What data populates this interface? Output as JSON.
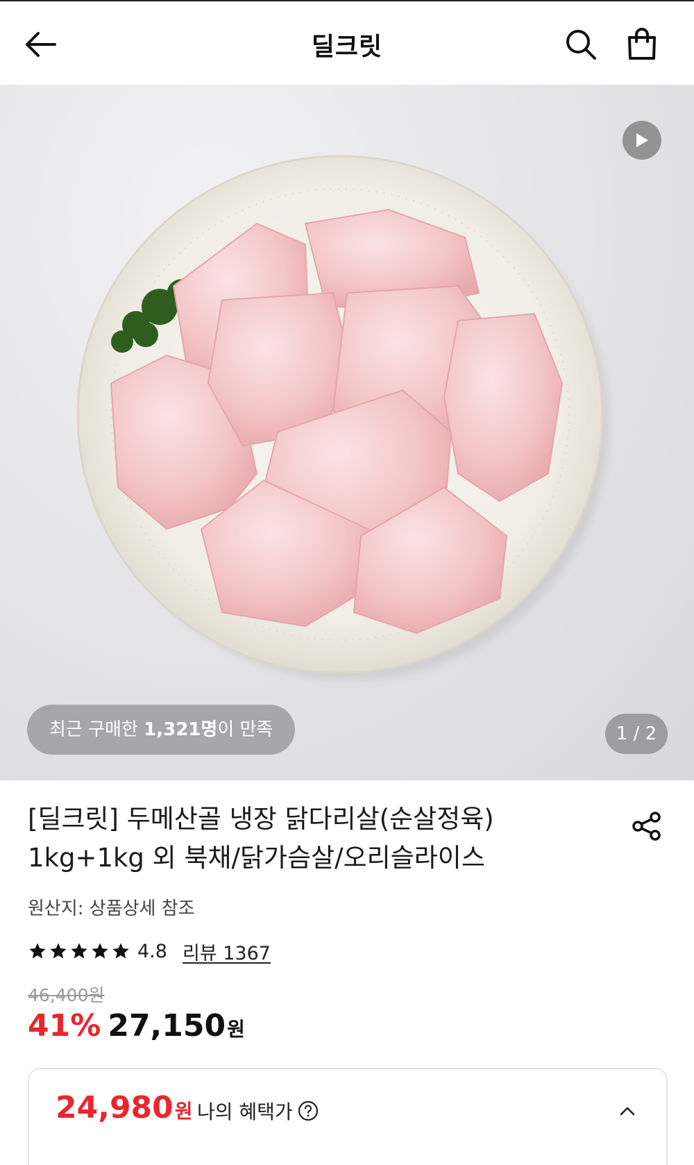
{
  "header": {
    "title": "딜크릿",
    "back_icon": "arrow-left-icon",
    "search_icon": "search-icon",
    "cart_icon": "shopping-bag-icon"
  },
  "hero": {
    "play_icon": "play-icon",
    "satisfaction": {
      "prefix": "최근 구매한 ",
      "count": "1,321명",
      "suffix": "이 만족"
    },
    "image_counter": "1 / 2"
  },
  "product": {
    "title_line1": "[딜크릿] 두메산골 냉장 닭다리살(순살정육)",
    "title_line2": "1kg+1kg 외 북채/닭가슴살/오리슬라이스",
    "origin": "원산지: 상품상세 참조",
    "rating": {
      "stars": 5,
      "value": "4.8",
      "reviews_label": "리뷰 1367"
    },
    "original_price": "46,400원",
    "discount": "41%",
    "price": "27,150",
    "currency": "원"
  },
  "benefit": {
    "price": "24,980",
    "currency": "원",
    "label": "나의 혜택가",
    "help_icon": "question-circle-icon",
    "toggle_icon": "chevron-up-icon"
  },
  "colors": {
    "accent_red": "#e8262e",
    "text_dark": "#111111",
    "text_muted": "#999999"
  }
}
